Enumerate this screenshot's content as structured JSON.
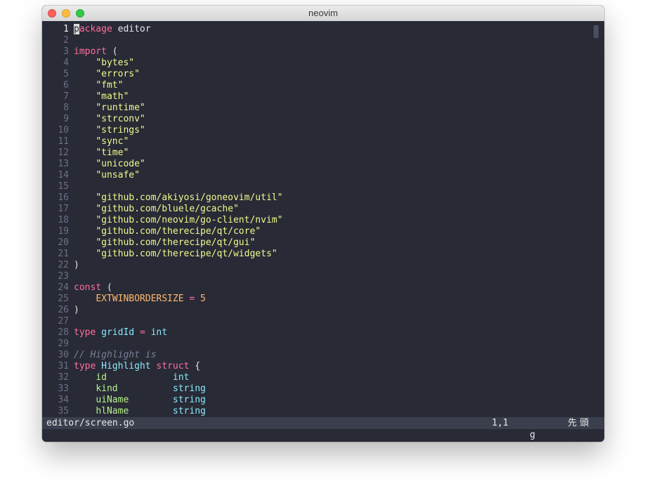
{
  "window": {
    "title": "neovim"
  },
  "code": {
    "lines": [
      {
        "n": "1",
        "toks": [
          {
            "c": "cursor",
            "t": "p"
          },
          {
            "c": "kw",
            "t": "ackage"
          },
          {
            "c": "plain",
            "t": " editor"
          }
        ]
      },
      {
        "n": "2",
        "toks": []
      },
      {
        "n": "3",
        "toks": [
          {
            "c": "kw",
            "t": "import"
          },
          {
            "c": "plain",
            "t": " ("
          }
        ]
      },
      {
        "n": "4",
        "toks": [
          {
            "c": "plain",
            "t": "    "
          },
          {
            "c": "str",
            "t": "\"bytes\""
          }
        ]
      },
      {
        "n": "5",
        "toks": [
          {
            "c": "plain",
            "t": "    "
          },
          {
            "c": "str",
            "t": "\"errors\""
          }
        ]
      },
      {
        "n": "6",
        "toks": [
          {
            "c": "plain",
            "t": "    "
          },
          {
            "c": "str",
            "t": "\"fmt\""
          }
        ]
      },
      {
        "n": "7",
        "toks": [
          {
            "c": "plain",
            "t": "    "
          },
          {
            "c": "str",
            "t": "\"math\""
          }
        ]
      },
      {
        "n": "8",
        "toks": [
          {
            "c": "plain",
            "t": "    "
          },
          {
            "c": "str",
            "t": "\"runtime\""
          }
        ]
      },
      {
        "n": "9",
        "toks": [
          {
            "c": "plain",
            "t": "    "
          },
          {
            "c": "str",
            "t": "\"strconv\""
          }
        ]
      },
      {
        "n": "10",
        "toks": [
          {
            "c": "plain",
            "t": "    "
          },
          {
            "c": "str",
            "t": "\"strings\""
          }
        ]
      },
      {
        "n": "11",
        "toks": [
          {
            "c": "plain",
            "t": "    "
          },
          {
            "c": "str",
            "t": "\"sync\""
          }
        ]
      },
      {
        "n": "12",
        "toks": [
          {
            "c": "plain",
            "t": "    "
          },
          {
            "c": "str",
            "t": "\"time\""
          }
        ]
      },
      {
        "n": "13",
        "toks": [
          {
            "c": "plain",
            "t": "    "
          },
          {
            "c": "str",
            "t": "\"unicode\""
          }
        ]
      },
      {
        "n": "14",
        "toks": [
          {
            "c": "plain",
            "t": "    "
          },
          {
            "c": "str",
            "t": "\"unsafe\""
          }
        ]
      },
      {
        "n": "15",
        "toks": []
      },
      {
        "n": "16",
        "toks": [
          {
            "c": "plain",
            "t": "    "
          },
          {
            "c": "str",
            "t": "\"github.com/akiyosi/goneovim/util\""
          }
        ]
      },
      {
        "n": "17",
        "toks": [
          {
            "c": "plain",
            "t": "    "
          },
          {
            "c": "str",
            "t": "\"github.com/bluele/gcache\""
          }
        ]
      },
      {
        "n": "18",
        "toks": [
          {
            "c": "plain",
            "t": "    "
          },
          {
            "c": "str",
            "t": "\"github.com/neovim/go-client/nvim\""
          }
        ]
      },
      {
        "n": "19",
        "toks": [
          {
            "c": "plain",
            "t": "    "
          },
          {
            "c": "str",
            "t": "\"github.com/therecipe/qt/core\""
          }
        ]
      },
      {
        "n": "20",
        "toks": [
          {
            "c": "plain",
            "t": "    "
          },
          {
            "c": "str",
            "t": "\"github.com/therecipe/qt/gui\""
          }
        ]
      },
      {
        "n": "21",
        "toks": [
          {
            "c": "plain",
            "t": "    "
          },
          {
            "c": "str",
            "t": "\"github.com/therecipe/qt/widgets\""
          }
        ]
      },
      {
        "n": "22",
        "toks": [
          {
            "c": "plain",
            "t": ")"
          }
        ]
      },
      {
        "n": "23",
        "toks": []
      },
      {
        "n": "24",
        "toks": [
          {
            "c": "kw",
            "t": "const"
          },
          {
            "c": "plain",
            "t": " ("
          }
        ]
      },
      {
        "n": "25",
        "toks": [
          {
            "c": "plain",
            "t": "    "
          },
          {
            "c": "const",
            "t": "EXTWINBORDERSIZE"
          },
          {
            "c": "plain",
            "t": " "
          },
          {
            "c": "kw",
            "t": "="
          },
          {
            "c": "plain",
            "t": " "
          },
          {
            "c": "const",
            "t": "5"
          }
        ]
      },
      {
        "n": "26",
        "toks": [
          {
            "c": "plain",
            "t": ")"
          }
        ]
      },
      {
        "n": "27",
        "toks": []
      },
      {
        "n": "28",
        "toks": [
          {
            "c": "kw",
            "t": "type"
          },
          {
            "c": "plain",
            "t": " "
          },
          {
            "c": "ty",
            "t": "gridId"
          },
          {
            "c": "plain",
            "t": " "
          },
          {
            "c": "kw",
            "t": "="
          },
          {
            "c": "plain",
            "t": " "
          },
          {
            "c": "ty",
            "t": "int"
          }
        ]
      },
      {
        "n": "29",
        "toks": []
      },
      {
        "n": "30",
        "toks": [
          {
            "c": "cmt",
            "t": "// Highlight is"
          }
        ]
      },
      {
        "n": "31",
        "toks": [
          {
            "c": "kw",
            "t": "type"
          },
          {
            "c": "plain",
            "t": " "
          },
          {
            "c": "ty",
            "t": "Highlight"
          },
          {
            "c": "plain",
            "t": " "
          },
          {
            "c": "kw",
            "t": "struct"
          },
          {
            "c": "plain",
            "t": " {"
          }
        ]
      },
      {
        "n": "32",
        "toks": [
          {
            "c": "plain",
            "t": "    "
          },
          {
            "c": "field",
            "t": "id"
          },
          {
            "c": "plain",
            "t": "            "
          },
          {
            "c": "ty",
            "t": "int"
          }
        ]
      },
      {
        "n": "33",
        "toks": [
          {
            "c": "plain",
            "t": "    "
          },
          {
            "c": "field",
            "t": "kind"
          },
          {
            "c": "plain",
            "t": "          "
          },
          {
            "c": "ty",
            "t": "string"
          }
        ]
      },
      {
        "n": "34",
        "toks": [
          {
            "c": "plain",
            "t": "    "
          },
          {
            "c": "field",
            "t": "uiName"
          },
          {
            "c": "plain",
            "t": "        "
          },
          {
            "c": "ty",
            "t": "string"
          }
        ]
      },
      {
        "n": "35",
        "toks": [
          {
            "c": "plain",
            "t": "    "
          },
          {
            "c": "field",
            "t": "hlName"
          },
          {
            "c": "plain",
            "t": "        "
          },
          {
            "c": "ty",
            "t": "string"
          }
        ]
      }
    ]
  },
  "statusline": {
    "file": "editor/screen.go",
    "position": "1,1",
    "encoding": "先 頭"
  },
  "cmdline": {
    "pending_key": "g"
  },
  "colors": {
    "background": "#282a36",
    "keyword": "#ff6e9e",
    "type": "#8be9fd",
    "string": "#f1fa8c",
    "constant": "#ffb86c",
    "field": "#b8f28a",
    "comment": "#7a7f99"
  }
}
